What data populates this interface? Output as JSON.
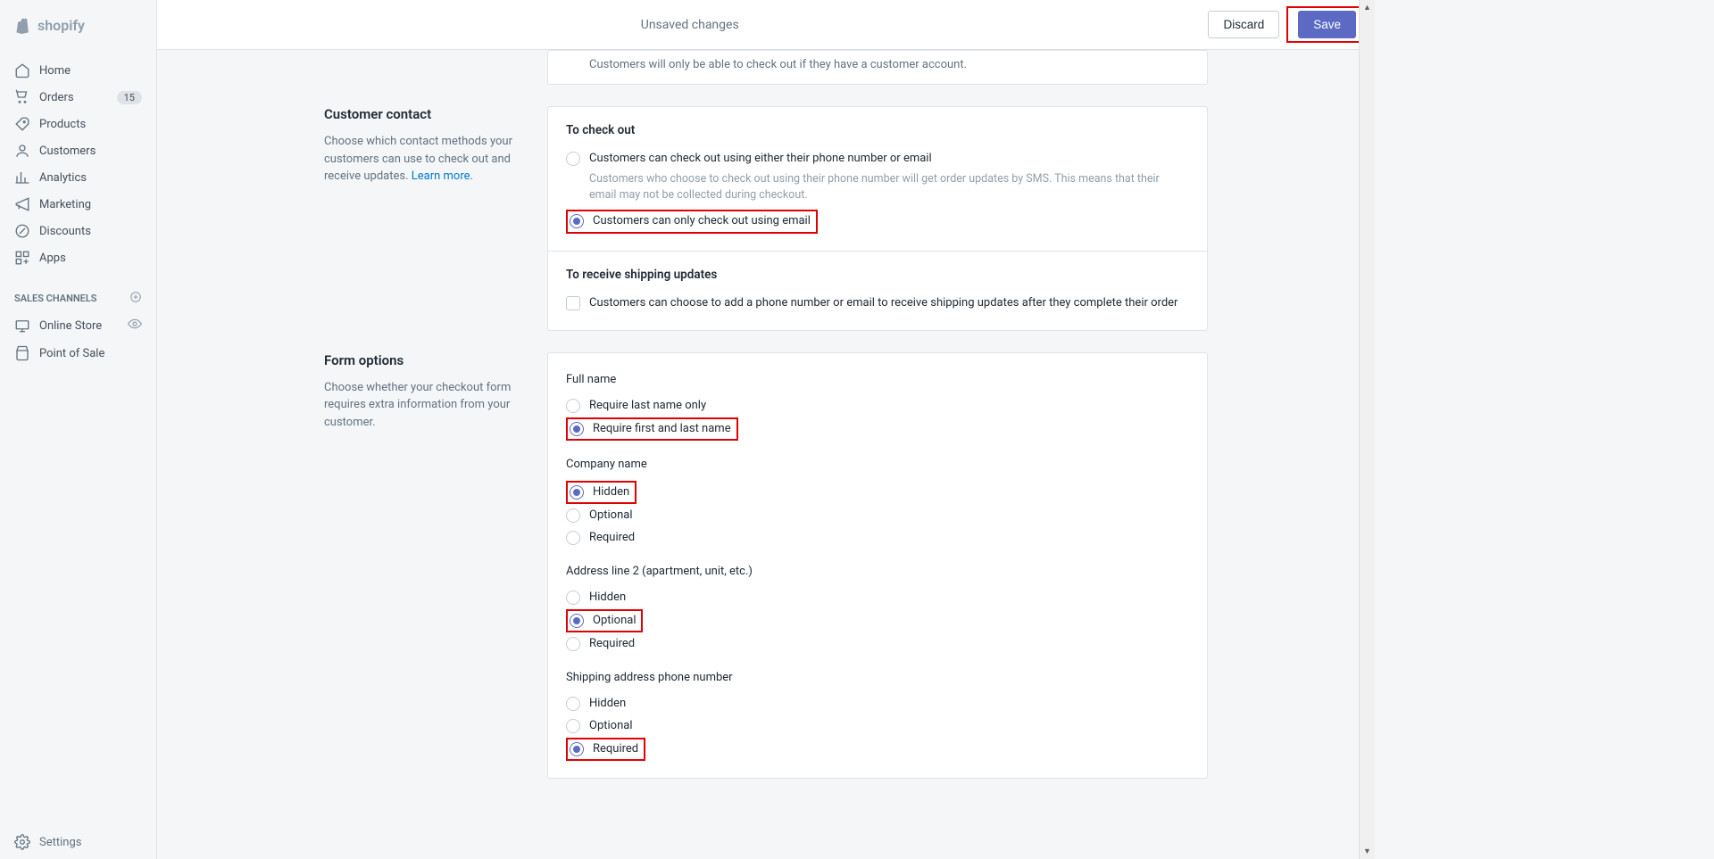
{
  "brand": "shopify",
  "topbar": {
    "status": "Unsaved changes",
    "discard": "Discard",
    "save": "Save"
  },
  "sidebar": {
    "items": [
      {
        "label": "Home"
      },
      {
        "label": "Orders",
        "badge": "15"
      },
      {
        "label": "Products"
      },
      {
        "label": "Customers"
      },
      {
        "label": "Analytics"
      },
      {
        "label": "Marketing"
      },
      {
        "label": "Discounts"
      },
      {
        "label": "Apps"
      }
    ],
    "channels_heading": "SALES CHANNELS",
    "channels": [
      {
        "label": "Online Store"
      },
      {
        "label": "Point of Sale"
      }
    ],
    "settings": "Settings"
  },
  "sections": {
    "partial_card_text": "Customers will only be able to check out if they have a customer account.",
    "customer_contact": {
      "title": "Customer contact",
      "desc": "Choose which contact methods your customers can use to check out and receive updates. ",
      "learn_more": "Learn more.",
      "checkout_heading": "To check out",
      "opt1_label": "Customers can check out using either their phone number or email",
      "opt1_sub": "Customers who choose to check out using their phone number will get order updates by SMS. This means that their email may not be collected during checkout.",
      "opt2_label": "Customers can only check out using email",
      "updates_heading": "To receive shipping updates",
      "updates_label": "Customers can choose to add a phone number or email to receive shipping updates after they complete their order"
    },
    "form_options": {
      "title": "Form options",
      "desc": "Choose whether your checkout form requires extra information from your customer.",
      "full_name": {
        "heading": "Full name",
        "opt1": "Require last name only",
        "opt2": "Require first and last name"
      },
      "company": {
        "heading": "Company name",
        "hidden": "Hidden",
        "optional": "Optional",
        "required": "Required"
      },
      "address2": {
        "heading": "Address line 2 (apartment, unit, etc.)",
        "hidden": "Hidden",
        "optional": "Optional",
        "required": "Required"
      },
      "phone": {
        "heading": "Shipping address phone number",
        "hidden": "Hidden",
        "optional": "Optional",
        "required": "Required"
      }
    }
  }
}
